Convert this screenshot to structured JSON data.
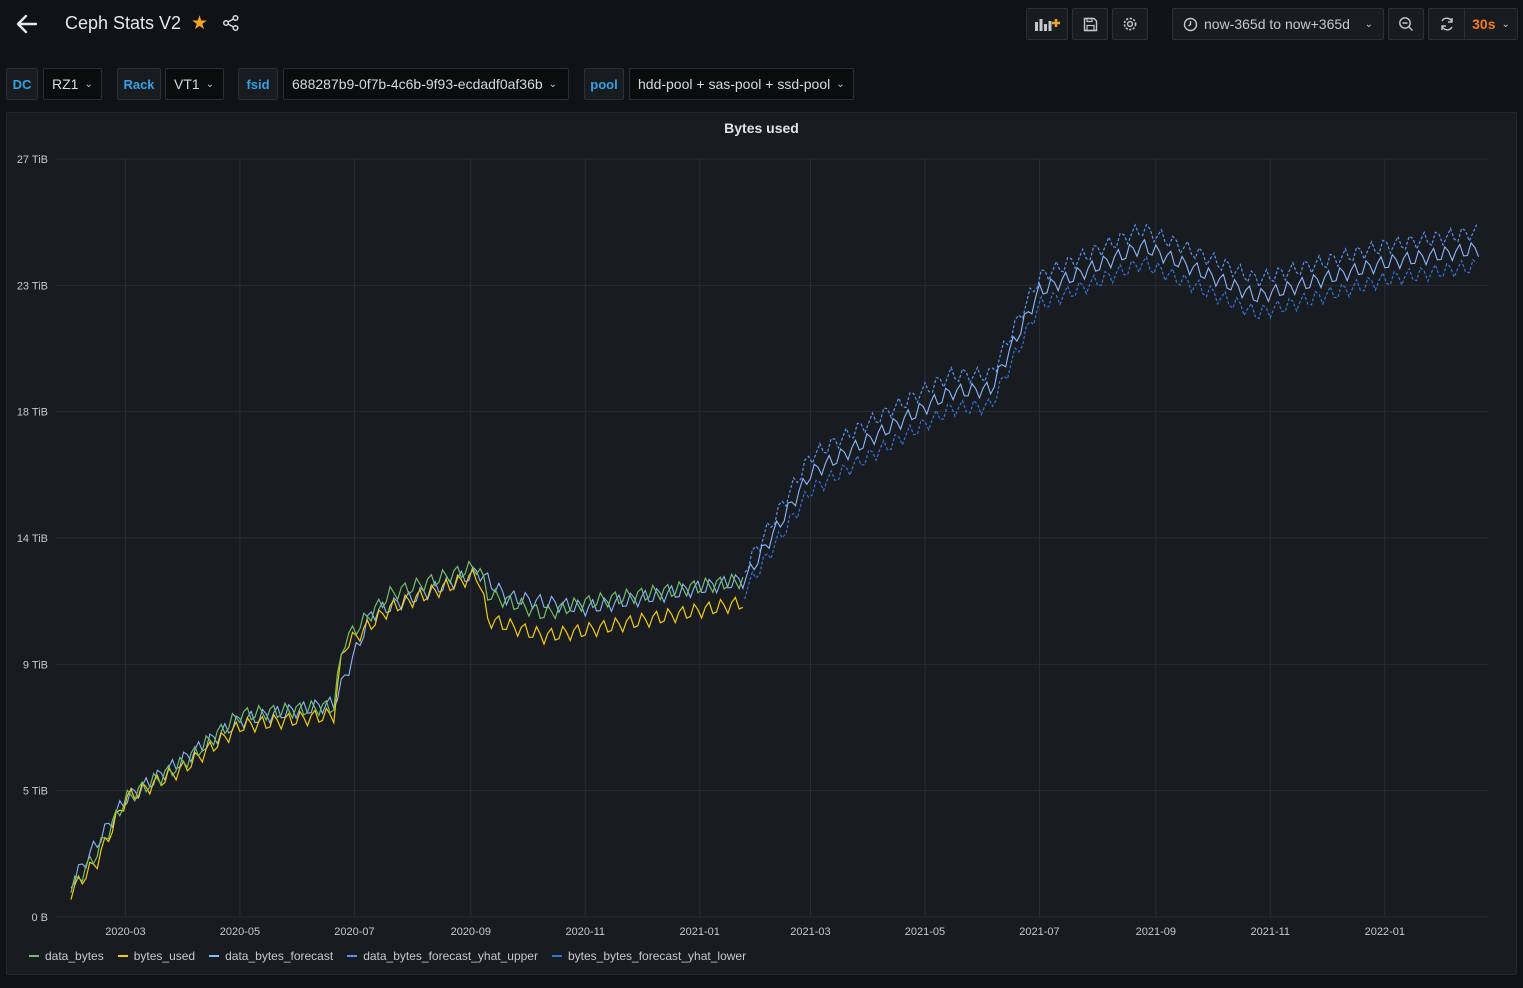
{
  "header": {
    "title": "Ceph Stats V2",
    "time_range": "now-365d to now+365d",
    "refresh_rate": "30s"
  },
  "variables": [
    {
      "label": "DC",
      "value": "RZ1"
    },
    {
      "label": "Rack",
      "value": "VT1"
    },
    {
      "label": "fsid",
      "value": "688287b9-0f7b-4c6b-9f93-ecdadf0af36b"
    },
    {
      "label": "pool",
      "value": "hdd-pool + sas-pool + ssd-pool"
    }
  ],
  "colors": {
    "data_bytes": "#73bf69",
    "bytes_used": "#f2cc0c",
    "data_bytes_forecast": "#8ab8ff",
    "data_bytes_forecast_yhat_upper": "#5794f2",
    "bytes_bytes_forecast_yhat_lower": "#3274d9",
    "accent": "#f57b20"
  },
  "chart_data": {
    "type": "line",
    "title": "Bytes used",
    "y_ticks": [
      "0 B",
      "5 TiB",
      "9 TiB",
      "14 TiB",
      "18 TiB",
      "23 TiB",
      "27 TiB"
    ],
    "x_ticks": [
      "2020-03",
      "2020-05",
      "2020-07",
      "2020-09",
      "2020-11",
      "2021-01",
      "2021-03",
      "2021-05",
      "2021-07",
      "2021-09",
      "2021-11",
      "2022-01"
    ],
    "ylim_tib": [
      0,
      27
    ],
    "grid": true,
    "legend_position": "bottom-left",
    "series": [
      {
        "name": "data_bytes",
        "points": [
          [
            "2020-02-01",
            1.0
          ],
          [
            "2020-02-15",
            2.3
          ],
          [
            "2020-03-01",
            4.2
          ],
          [
            "2020-03-15",
            4.8
          ],
          [
            "2020-04-01",
            5.5
          ],
          [
            "2020-05-01",
            7.2
          ],
          [
            "2020-06-20",
            7.5
          ],
          [
            "2020-06-25",
            9.8
          ],
          [
            "2020-07-20",
            11.5
          ],
          [
            "2020-09-05",
            12.5
          ],
          [
            "2020-09-10",
            11.5
          ],
          [
            "2020-10-10",
            10.8
          ],
          [
            "2020-11-01",
            11.2
          ],
          [
            "2021-01-25",
            12.0
          ]
        ]
      },
      {
        "name": "bytes_used",
        "points": [
          [
            "2020-02-01",
            0.9
          ],
          [
            "2020-02-15",
            2.0
          ],
          [
            "2020-03-01",
            4.2
          ],
          [
            "2020-04-01",
            5.3
          ],
          [
            "2020-05-01",
            6.8
          ],
          [
            "2020-06-20",
            7.2
          ],
          [
            "2020-06-25",
            9.6
          ],
          [
            "2020-07-20",
            11.0
          ],
          [
            "2020-09-05",
            12.2
          ],
          [
            "2020-09-10",
            10.6
          ],
          [
            "2020-10-10",
            10.0
          ],
          [
            "2020-11-01",
            10.2
          ],
          [
            "2021-01-25",
            11.2
          ]
        ]
      },
      {
        "name": "data_bytes_forecast",
        "points": [
          [
            "2020-02-01",
            1.2
          ],
          [
            "2020-03-01",
            4.2
          ],
          [
            "2020-05-01",
            7.0
          ],
          [
            "2020-06-20",
            7.6
          ],
          [
            "2020-07-10",
            10.8
          ],
          [
            "2020-09-05",
            12.3
          ],
          [
            "2020-09-20",
            11.4
          ],
          [
            "2020-11-01",
            11.0
          ],
          [
            "2021-01-25",
            12.0
          ],
          [
            "2021-03-01",
            15.8
          ],
          [
            "2021-05-15",
            18.7
          ],
          [
            "2021-06-05",
            18.8
          ],
          [
            "2021-07-01",
            22.3
          ],
          [
            "2021-08-25",
            23.9
          ],
          [
            "2021-10-25",
            22.1
          ],
          [
            "2022-01-01",
            23.3
          ],
          [
            "2022-02-20",
            23.8
          ]
        ]
      },
      {
        "name": "data_bytes_forecast_yhat_upper",
        "points": [
          [
            "2021-01-25",
            12.4
          ],
          [
            "2021-03-01",
            16.4
          ],
          [
            "2021-05-15",
            19.3
          ],
          [
            "2021-06-05",
            19.3
          ],
          [
            "2021-07-01",
            22.8
          ],
          [
            "2021-08-25",
            24.5
          ],
          [
            "2021-10-25",
            22.7
          ],
          [
            "2022-01-01",
            23.9
          ],
          [
            "2022-02-20",
            24.4
          ]
        ]
      },
      {
        "name": "bytes_bytes_forecast_yhat_lower",
        "points": [
          [
            "2021-01-25",
            11.6
          ],
          [
            "2021-03-01",
            15.2
          ],
          [
            "2021-05-15",
            18.1
          ],
          [
            "2021-06-05",
            18.2
          ],
          [
            "2021-07-01",
            21.8
          ],
          [
            "2021-08-25",
            23.3
          ],
          [
            "2021-10-25",
            21.5
          ],
          [
            "2022-01-01",
            22.7
          ],
          [
            "2022-02-20",
            23.2
          ]
        ]
      }
    ]
  }
}
